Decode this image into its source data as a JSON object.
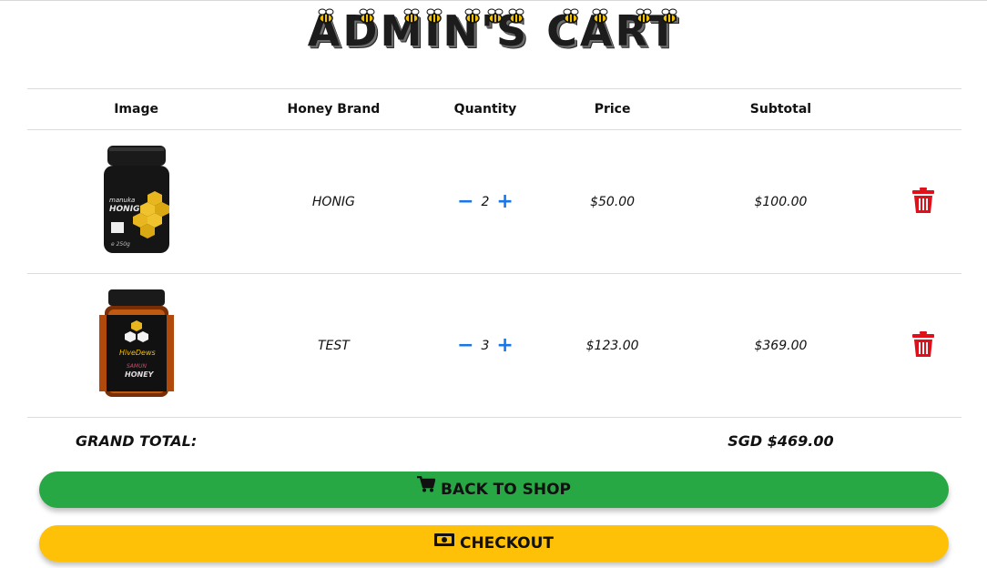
{
  "header": {
    "title": "ADMIN'S CART"
  },
  "table": {
    "columns": [
      "Image",
      "Honey Brand",
      "Quantity",
      "Price",
      "Subtotal"
    ],
    "rows": [
      {
        "image_label": "manuka HONIG",
        "brand": "HONIG",
        "qty": "2",
        "price": "$50.00",
        "subtotal": "$100.00"
      },
      {
        "image_label": "HiveDews SAMUN HONEY",
        "brand": "TEST",
        "qty": "3",
        "price": "$123.00",
        "subtotal": "$369.00"
      }
    ],
    "grand_total_label": "GRAND TOTAL:",
    "grand_total_value": "SGD $469.00"
  },
  "buttons": {
    "back_label": "BACK TO SHOP",
    "checkout_label": "CHECKOUT"
  },
  "colors": {
    "back_button": "#28a745",
    "checkout_button": "#ffc107",
    "qty_controls": "#1877e8",
    "trash": "#e0101a"
  },
  "icons": [
    "bee-icon",
    "minus-icon",
    "plus-icon",
    "trash-icon",
    "cart-icon",
    "money-icon"
  ]
}
